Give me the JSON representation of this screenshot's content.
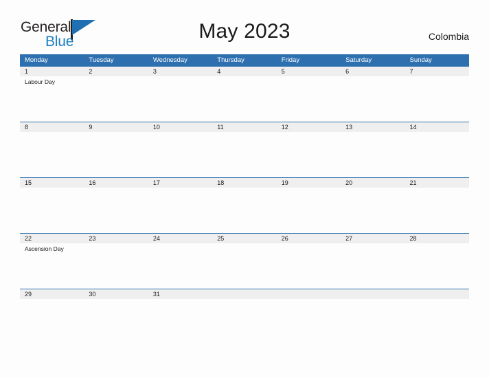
{
  "brand": {
    "name_top": "General",
    "name_bottom": "Blue",
    "accent_color": "#1f6fb2",
    "text_color": "#231f20"
  },
  "header": {
    "title": "May 2023",
    "country": "Colombia"
  },
  "calendar": {
    "header_bg": "#2e70af",
    "date_band_bg": "#efefef",
    "weekdays": [
      "Monday",
      "Tuesday",
      "Wednesday",
      "Thursday",
      "Friday",
      "Saturday",
      "Sunday"
    ],
    "weeks": [
      {
        "days": [
          {
            "date": "1",
            "event": "Labour Day"
          },
          {
            "date": "2",
            "event": ""
          },
          {
            "date": "3",
            "event": ""
          },
          {
            "date": "4",
            "event": ""
          },
          {
            "date": "5",
            "event": ""
          },
          {
            "date": "6",
            "event": ""
          },
          {
            "date": "7",
            "event": ""
          }
        ]
      },
      {
        "days": [
          {
            "date": "8",
            "event": ""
          },
          {
            "date": "9",
            "event": ""
          },
          {
            "date": "10",
            "event": ""
          },
          {
            "date": "11",
            "event": ""
          },
          {
            "date": "12",
            "event": ""
          },
          {
            "date": "13",
            "event": ""
          },
          {
            "date": "14",
            "event": ""
          }
        ]
      },
      {
        "days": [
          {
            "date": "15",
            "event": ""
          },
          {
            "date": "16",
            "event": ""
          },
          {
            "date": "17",
            "event": ""
          },
          {
            "date": "18",
            "event": ""
          },
          {
            "date": "19",
            "event": ""
          },
          {
            "date": "20",
            "event": ""
          },
          {
            "date": "21",
            "event": ""
          }
        ]
      },
      {
        "days": [
          {
            "date": "22",
            "event": "Ascension Day"
          },
          {
            "date": "23",
            "event": ""
          },
          {
            "date": "24",
            "event": ""
          },
          {
            "date": "25",
            "event": ""
          },
          {
            "date": "26",
            "event": ""
          },
          {
            "date": "27",
            "event": ""
          },
          {
            "date": "28",
            "event": ""
          }
        ]
      },
      {
        "days": [
          {
            "date": "29",
            "event": ""
          },
          {
            "date": "30",
            "event": ""
          },
          {
            "date": "31",
            "event": ""
          },
          {
            "date": "",
            "event": ""
          },
          {
            "date": "",
            "event": ""
          },
          {
            "date": "",
            "event": ""
          },
          {
            "date": "",
            "event": ""
          }
        ]
      }
    ]
  }
}
